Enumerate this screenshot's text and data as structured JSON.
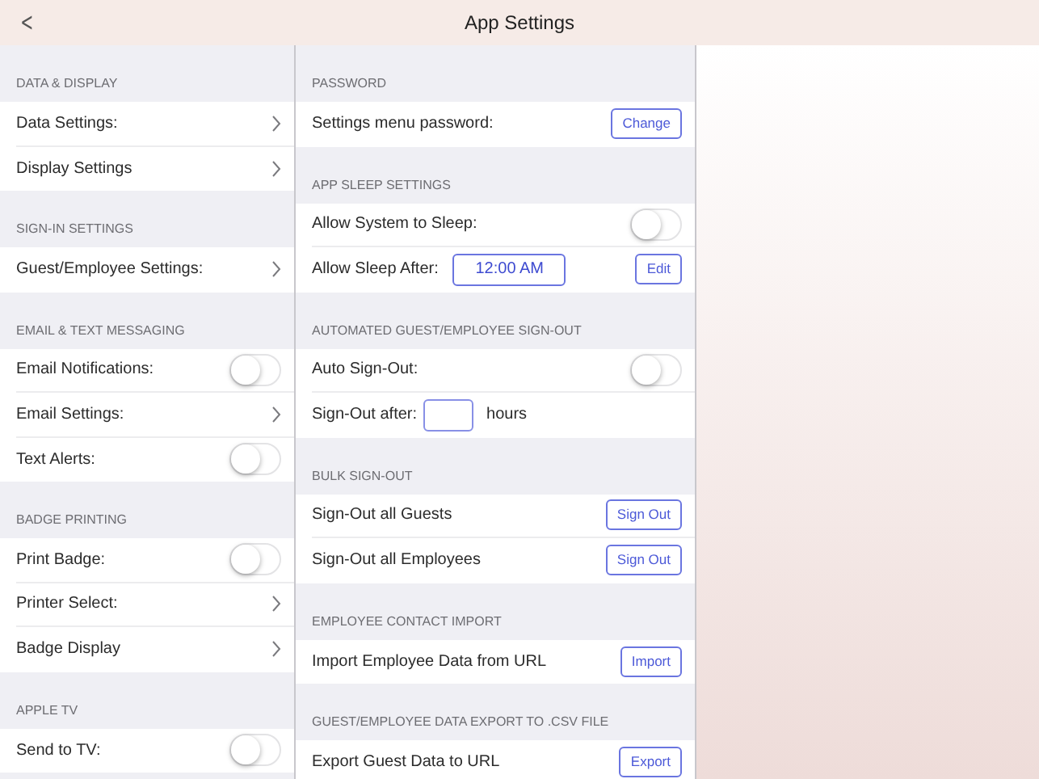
{
  "nav_bar": {
    "back_symbol": "<",
    "title": "App Settings"
  },
  "columns": [
    {
      "sections": [
        {
          "header": "DATA & DISPLAY",
          "rows": [
            {
              "kind": "nav",
              "label": "Data Settings:"
            },
            {
              "kind": "nav",
              "label": "Display Settings"
            }
          ]
        },
        {
          "header": "SIGN-IN SETTINGS",
          "rows": [
            {
              "kind": "nav",
              "label": "Guest/Employee Settings:"
            }
          ]
        },
        {
          "header": "EMAIL & TEXT MESSAGING",
          "rows": [
            {
              "kind": "toggle",
              "label": "Email Notifications:",
              "on": false
            },
            {
              "kind": "nav",
              "label": "Email Settings:"
            },
            {
              "kind": "toggle",
              "label": "Text Alerts:",
              "on": false
            }
          ]
        },
        {
          "header": "BADGE PRINTING",
          "rows": [
            {
              "kind": "toggle",
              "label": "Print Badge:",
              "on": false
            },
            {
              "kind": "nav",
              "label": "Printer Select:"
            },
            {
              "kind": "nav",
              "label": "Badge Display"
            }
          ]
        },
        {
          "header": "APPLE TV",
          "rows": [
            {
              "kind": "toggle",
              "label": "Send to TV:",
              "on": false
            }
          ]
        }
      ]
    },
    {
      "sections": [
        {
          "header": "PASSWORD",
          "rows": [
            {
              "kind": "button",
              "label": "Settings menu password:",
              "button": "Change"
            }
          ]
        },
        {
          "header": "APP SLEEP SETTINGS",
          "rows": [
            {
              "kind": "toggle",
              "label": "Allow System to Sleep:",
              "on": false
            },
            {
              "kind": "time",
              "label": "Allow Sleep After:",
              "value": "12:00 AM",
              "button": "Edit"
            }
          ]
        },
        {
          "header": "AUTOMATED GUEST/EMPLOYEE SIGN-OUT",
          "rows": [
            {
              "kind": "toggle",
              "label": "Auto Sign-Out:",
              "on": false
            },
            {
              "kind": "input",
              "label": "Sign-Out after:",
              "suffix": "hours"
            }
          ]
        },
        {
          "header": "BULK SIGN-OUT",
          "rows": [
            {
              "kind": "button",
              "label": "Sign-Out all Guests",
              "button": "Sign Out"
            },
            {
              "kind": "button",
              "label": "Sign-Out all Employees",
              "button": "Sign Out"
            }
          ]
        },
        {
          "header": "EMPLOYEE CONTACT IMPORT",
          "rows": [
            {
              "kind": "button",
              "label": "Import Employee Data from URL",
              "button": "Import"
            }
          ]
        },
        {
          "header": "GUEST/EMPLOYEE DATA EXPORT TO .CSV FILE",
          "rows": [
            {
              "kind": "button",
              "label": "Export Guest Data to URL",
              "button": "Export"
            }
          ]
        }
      ]
    }
  ]
}
